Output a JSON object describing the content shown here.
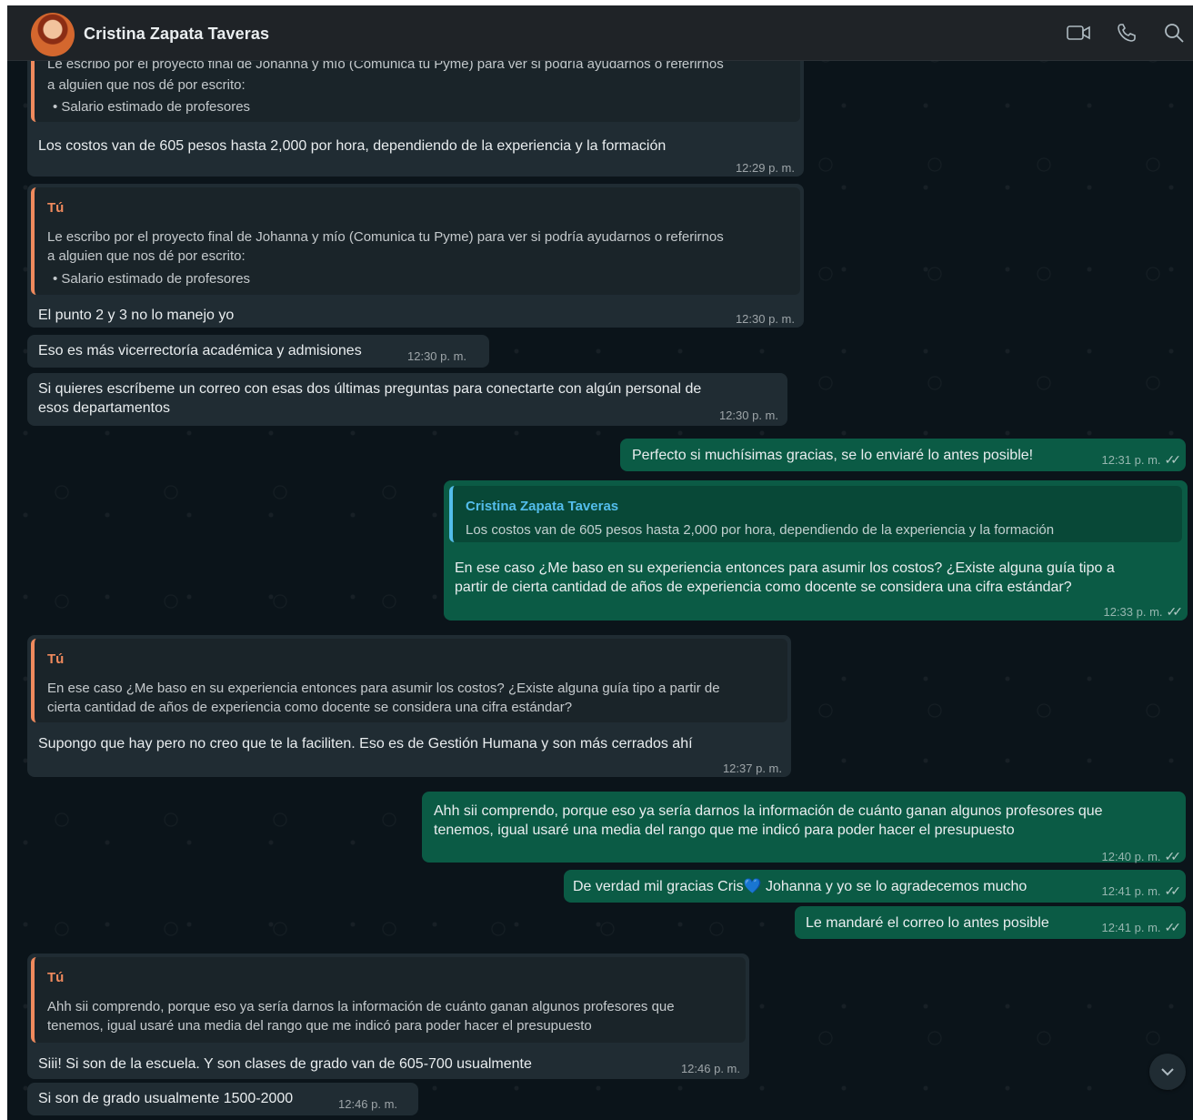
{
  "header": {
    "contact_name": "Cristina Zapata Taveras",
    "icons": [
      "video-call-icon",
      "voice-call-icon",
      "search-icon"
    ]
  },
  "colors": {
    "background": "#0b141a",
    "incoming_bubble": "#202c33",
    "outgoing_bubble": "#0b5b45",
    "quote_you_accent": "#f08a5d",
    "quote_contact_accent": "#53bdeb"
  },
  "messages": [
    {
      "direction": "in",
      "quote": {
        "author": "",
        "text_partial": "Le escribo por el proyecto final de Johanna y mío (Comunica tu Pyme) para ver si podría ayudarnos o referirnos",
        "text_line2": "a alguien que nos dé por escrito:",
        "bullet": "Salario estimado de profesores"
      },
      "text": "Los costos van de 605 pesos hasta 2,000 por hora, dependiendo de la experiencia y la formación",
      "time": "12:29 p. m."
    },
    {
      "direction": "in",
      "quote": {
        "author": "Tú",
        "text_line1": "Le escribo por el proyecto final de Johanna y mío (Comunica tu Pyme) para ver si podría ayudarnos o referirnos",
        "text_line2": "a alguien que nos dé por escrito:",
        "bullet": "Salario estimado de profesores"
      },
      "text": "El punto 2 y 3 no lo manejo yo",
      "time": "12:30 p. m."
    },
    {
      "direction": "in",
      "text": "Eso es más vicerrectoría académica y admisiones",
      "time": "12:30 p. m."
    },
    {
      "direction": "in",
      "text_line1": "Si quieres escríbeme un correo con esas dos últimas preguntas para conectarte con algún personal de",
      "text_line2": "esos departamentos",
      "time": "12:30 p. m."
    },
    {
      "direction": "out",
      "text": "Perfecto si muchísimas gracias, se lo enviaré lo antes posible!",
      "time": "12:31 p. m."
    },
    {
      "direction": "out",
      "quote": {
        "author": "Cristina Zapata Taveras",
        "text_line1": "Los costos van de 605 pesos hasta 2,000 por hora, dependiendo de la experiencia y la formación"
      },
      "text_line1": "En ese caso ¿Me baso en su experiencia entonces para asumir los costos? ¿Existe alguna guía tipo a",
      "text_line2": "partir de cierta cantidad de años de experiencia como docente se considera una cifra estándar?",
      "time": "12:33 p. m."
    },
    {
      "direction": "in",
      "quote": {
        "author": "Tú",
        "text_line1": "En ese caso ¿Me baso en su experiencia entonces para asumir los costos? ¿Existe alguna guía tipo a partir de",
        "text_line2": "cierta cantidad de años de experiencia como docente se considera una cifra estándar?"
      },
      "text": "Supongo que hay pero no creo que te la faciliten. Eso es de Gestión Humana y son más cerrados ahí",
      "time": "12:37 p. m."
    },
    {
      "direction": "out",
      "text_line1": "Ahh sii comprendo, porque eso ya sería darnos la información de cuánto ganan algunos profesores que",
      "text_line2": "tenemos, igual usaré una media del rango que me indicó para poder hacer el presupuesto",
      "time": "12:40 p. m."
    },
    {
      "direction": "out",
      "text_before": "De verdad mil gracias Cris",
      "emoji": "💙",
      "text_after": " Johanna y yo se lo agradecemos mucho",
      "time": "12:41 p. m."
    },
    {
      "direction": "out",
      "text": "Le mandaré el correo lo antes posible",
      "time": "12:41 p. m."
    },
    {
      "direction": "in",
      "quote": {
        "author": "Tú",
        "text_line1": "Ahh sii comprendo, porque eso ya sería darnos la información de cuánto ganan algunos profesores que",
        "text_line2": "tenemos, igual usaré una media del rango que me indicó para poder hacer el presupuesto"
      },
      "text": "Siii! Si son de la escuela. Y son clases de grado van de 605-700 usualmente",
      "time": "12:46 p. m."
    },
    {
      "direction": "in",
      "text": "Si son de grado usualmente 1500-2000",
      "time": "12:46 p. m."
    }
  ],
  "ticks": "✓✓",
  "scroll_button_icon": "chevron-down-icon"
}
